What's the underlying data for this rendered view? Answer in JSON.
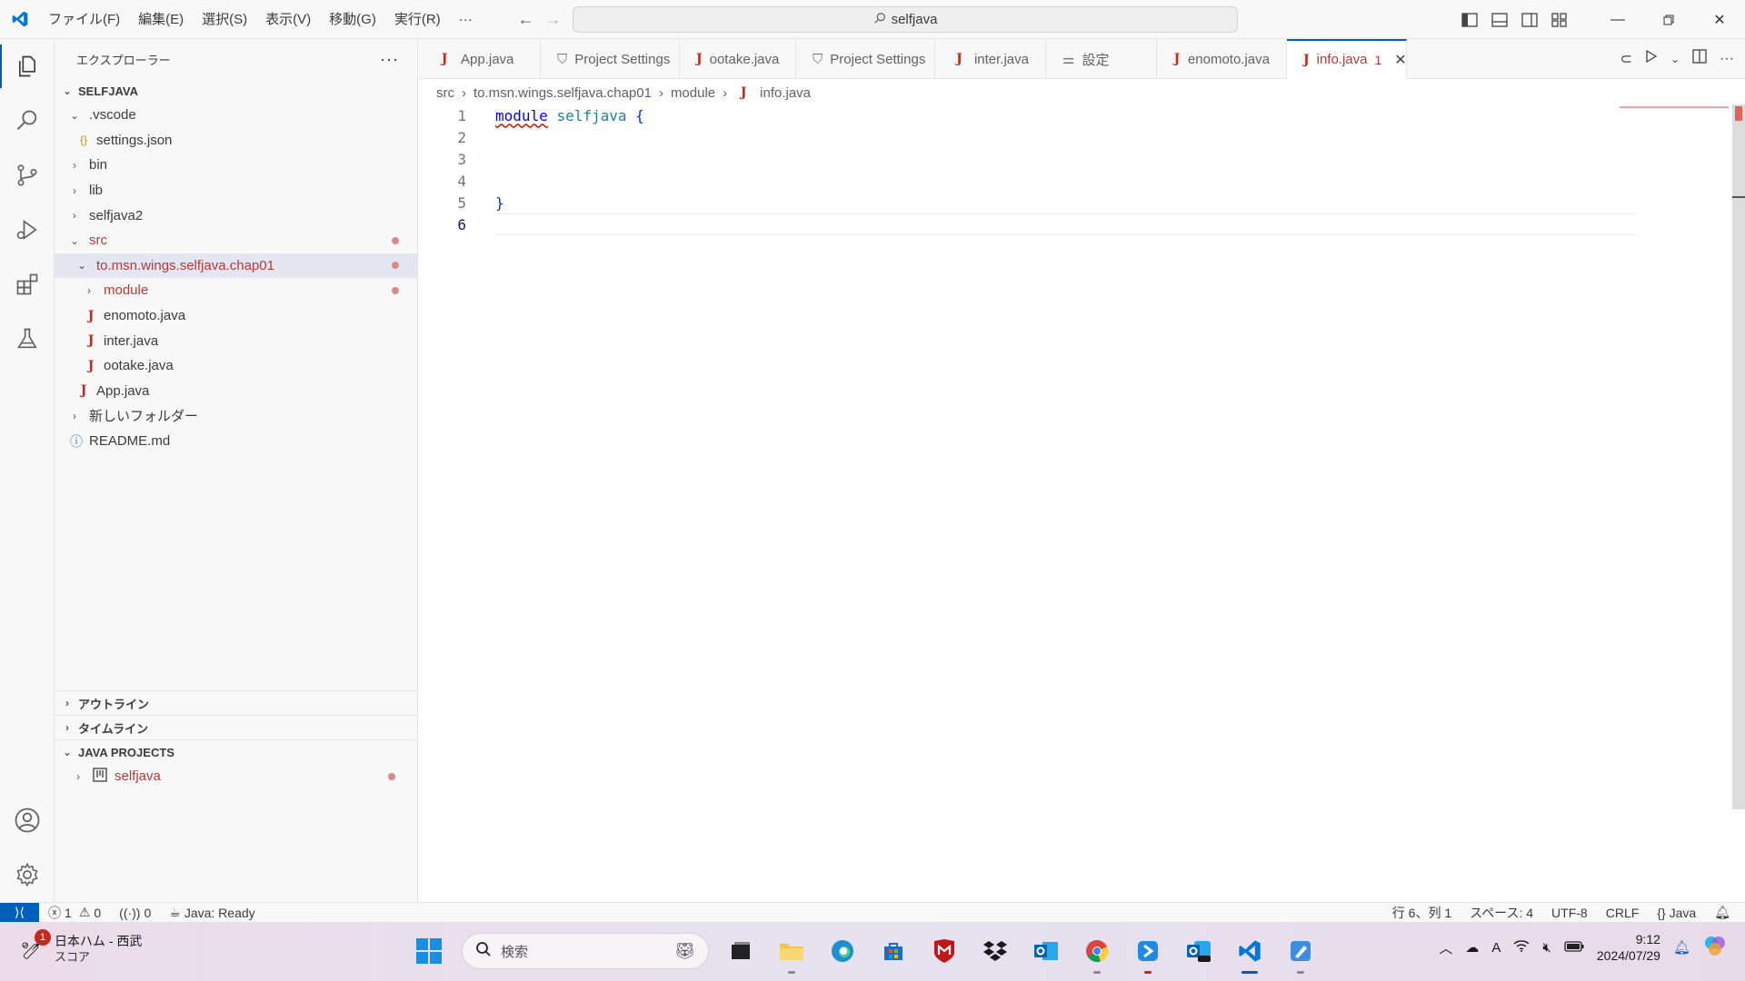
{
  "titlebar": {
    "menus": [
      "ファイル(F)",
      "編集(E)",
      "選択(S)",
      "表示(V)",
      "移動(G)",
      "実行(R)",
      "···"
    ],
    "search": "selfjava"
  },
  "sidebar": {
    "header": "エクスプローラー",
    "root": "SELFJAVA",
    "tree": [
      {
        "label": ".vscode",
        "type": "folder-open",
        "indent": 1
      },
      {
        "label": "settings.json",
        "type": "json",
        "indent": 2
      },
      {
        "label": "bin",
        "type": "folder",
        "indent": 1
      },
      {
        "label": "lib",
        "type": "folder",
        "indent": 1
      },
      {
        "label": "selfjava2",
        "type": "folder",
        "indent": 1
      },
      {
        "label": "src",
        "type": "folder-open",
        "indent": 1,
        "modified": true
      },
      {
        "label": "to.msn.wings.selfjava.chap01",
        "type": "folder-open",
        "indent": 2,
        "modified": true,
        "selected": true
      },
      {
        "label": "module",
        "type": "folder",
        "indent": 3,
        "modified": true
      },
      {
        "label": "enomoto.java",
        "type": "java",
        "indent": 3
      },
      {
        "label": "inter.java",
        "type": "java",
        "indent": 3
      },
      {
        "label": "ootake.java",
        "type": "java",
        "indent": 3
      },
      {
        "label": "App.java",
        "type": "java",
        "indent": 2
      },
      {
        "label": "新しいフォルダー",
        "type": "folder",
        "indent": 1
      },
      {
        "label": "README.md",
        "type": "info",
        "indent": 1
      }
    ],
    "outline": "アウトライン",
    "timeline": "タイムライン",
    "java_projects": "JAVA PROJECTS",
    "java_project_item": "selfjava"
  },
  "tabs": [
    {
      "label": "App.java",
      "icon": "java"
    },
    {
      "label": "Project Settings",
      "icon": "settings"
    },
    {
      "label": "ootake.java",
      "icon": "java"
    },
    {
      "label": "Project Settings",
      "icon": "settings"
    },
    {
      "label": "inter.java",
      "icon": "java"
    },
    {
      "label": "設定",
      "icon": "sliders"
    },
    {
      "label": "enomoto.java",
      "icon": "java"
    },
    {
      "label": "info.java",
      "icon": "java",
      "active": true,
      "badge": "1"
    }
  ],
  "breadcrumb": [
    "src",
    "to.msn.wings.selfjava.chap01",
    "module",
    "info.java"
  ],
  "editor": {
    "line_numbers": [
      "1",
      "2",
      "3",
      "4",
      "5",
      "6"
    ],
    "line1_keyword": "module",
    "line1_ident": "selfjava",
    "line1_brace": "{",
    "line5_brace": "}",
    "current_line": 6
  },
  "statusbar": {
    "errors": "1",
    "warnings": "0",
    "ports": "0",
    "java_status": "Java: Ready",
    "position": "行 6、列 1",
    "spaces": "スペース: 4",
    "encoding": "UTF-8",
    "eol": "CRLF",
    "language": "Java"
  },
  "taskbar": {
    "news_title": "日本ハム - 西武",
    "news_sub": "スコア",
    "news_badge": "1",
    "search_placeholder": "検索",
    "time": "9:12",
    "date": "2024/07/29"
  },
  "colors": {
    "accent": "#005fb8",
    "modified": "#b53a3a",
    "java": "#c5281c"
  }
}
